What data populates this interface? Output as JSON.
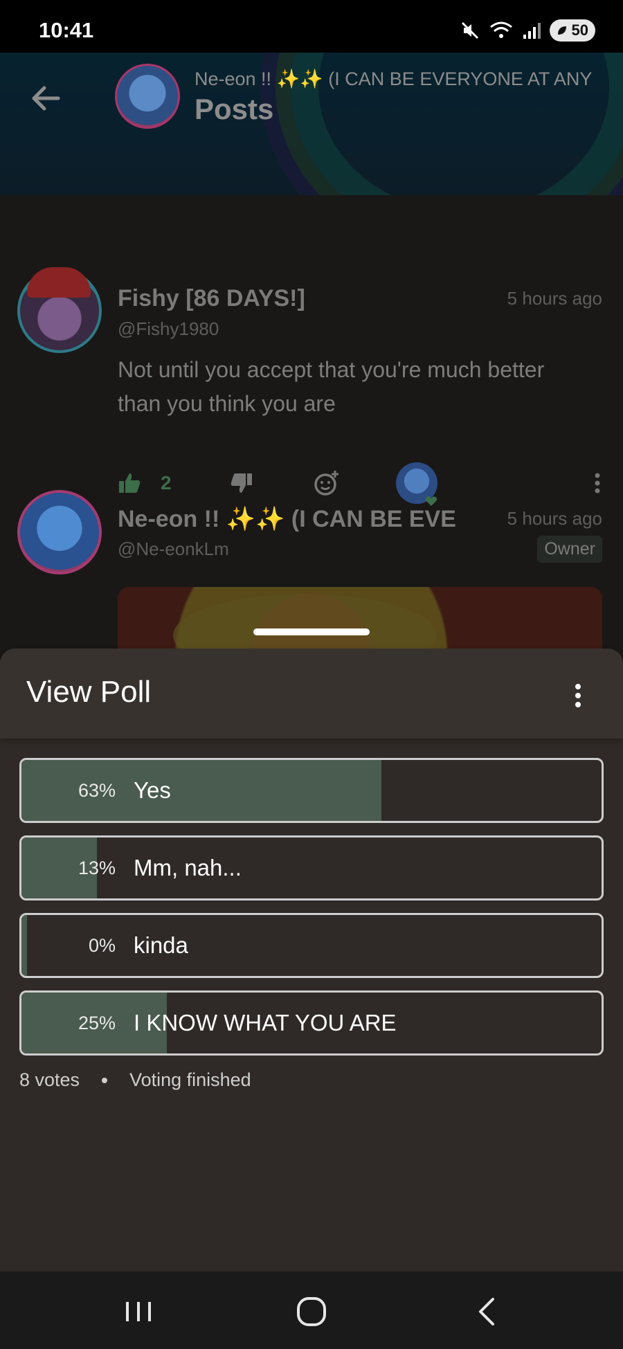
{
  "status_bar": {
    "time": "10:41",
    "battery": "50"
  },
  "header": {
    "title": "Ne-eon !! ✨✨ (I CAN BE EVERYONE AT ANY",
    "subtitle": "Posts"
  },
  "posts": [
    {
      "author": "Fishy [86 DAYS!]",
      "handle": "@Fishy1980",
      "time": "5 hours ago",
      "text": "Not until you accept that you're much better than you think you are",
      "likes": "2"
    },
    {
      "author": "Ne-eon !! ✨✨ (I CAN BE EVE",
      "handle": "@Ne-eonkLm",
      "time": "5 hours ago",
      "badge": "Owner"
    }
  ],
  "poll": {
    "title": "View Poll",
    "options": [
      {
        "percent": "63%",
        "label": "Yes",
        "fill": 0.62
      },
      {
        "percent": "13%",
        "label": "Mm, nah...",
        "fill": 0.13
      },
      {
        "percent": "0%",
        "label": "kinda",
        "fill": 0.01
      },
      {
        "percent": "25%",
        "label": "I KNOW WHAT YOU ARE",
        "fill": 0.25
      }
    ],
    "votes": "8 votes",
    "status": "Voting finished"
  },
  "colors": {
    "poll_fill": "#4a5b4f",
    "like_green": "#3c6e49",
    "sheet_bg": "#2f2a27"
  }
}
